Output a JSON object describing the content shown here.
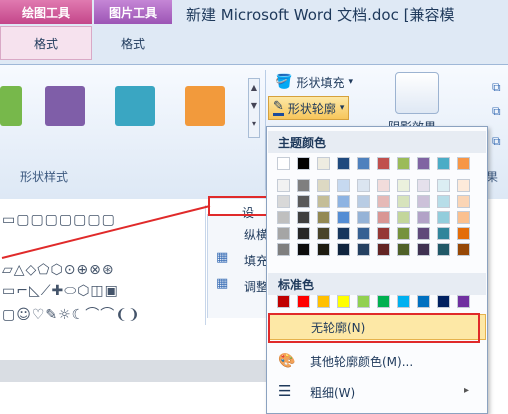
{
  "title_bar": {
    "tool_tab_1": "绘图工具",
    "tool_tab_1_sub": "格式",
    "tool_tab_2": "图片工具",
    "tool_tab_2_sub": "格式",
    "document_title": "新建 Microsoft Word 文档.doc [兼容模"
  },
  "ribbon": {
    "group_label": "形状样式",
    "fill_button": "形状填充",
    "outline_button": "形状轮廓",
    "partial_label_1": "阴影效果",
    "partial_label_2": "果",
    "style_swatches": [
      "#77b84b",
      "#7f5ea8",
      "#3aa6c2",
      "#f29a3c"
    ]
  },
  "side_panel": {
    "label_fill": "填充",
    "label_adjust": "调整",
    "label_partial_1": "设",
    "label_partial_2": "纵横"
  },
  "dropdown": {
    "theme_header": "主题颜色",
    "standard_header": "标准色",
    "no_outline": "无轮廓(N)",
    "more_colors": "其他轮廓颜色(M)...",
    "weight": "粗细(W)",
    "theme_top_row": [
      "#ffffff",
      "#000000",
      "#eeece1",
      "#1f497d",
      "#4f81bd",
      "#c0504d",
      "#9bbb59",
      "#8064a2",
      "#4bacc6",
      "#f79646"
    ],
    "theme_shades": [
      [
        "#f2f2f2",
        "#7f7f7f",
        "#ddd9c3",
        "#c6d9f0",
        "#dbe5f1",
        "#f2dcdb",
        "#ebf1dd",
        "#e5e0ec",
        "#dbeef3",
        "#fdeada"
      ],
      [
        "#d8d8d8",
        "#595959",
        "#c4bd97",
        "#8db3e2",
        "#b8cce4",
        "#e5b9b7",
        "#d7e3bc",
        "#ccc1d9",
        "#b7dde8",
        "#fbd5b5"
      ],
      [
        "#bfbfbf",
        "#3f3f3f",
        "#938953",
        "#548dd4",
        "#95b3d7",
        "#d99694",
        "#c3d69b",
        "#b2a2c7",
        "#92cddc",
        "#fac08f"
      ],
      [
        "#a5a5a5",
        "#262626",
        "#494429",
        "#17365d",
        "#366092",
        "#953734",
        "#76923c",
        "#5f497a",
        "#31859b",
        "#e36c09"
      ],
      [
        "#7f7f7f",
        "#0c0c0c",
        "#1d1b10",
        "#0f243e",
        "#244061",
        "#632423",
        "#4f6128",
        "#3f3151",
        "#205867",
        "#974806"
      ]
    ],
    "standard_row": [
      "#c00000",
      "#ff0000",
      "#ffc000",
      "#ffff00",
      "#92d050",
      "#00b050",
      "#00b0f0",
      "#0070c0",
      "#002060",
      "#7030a0"
    ]
  }
}
